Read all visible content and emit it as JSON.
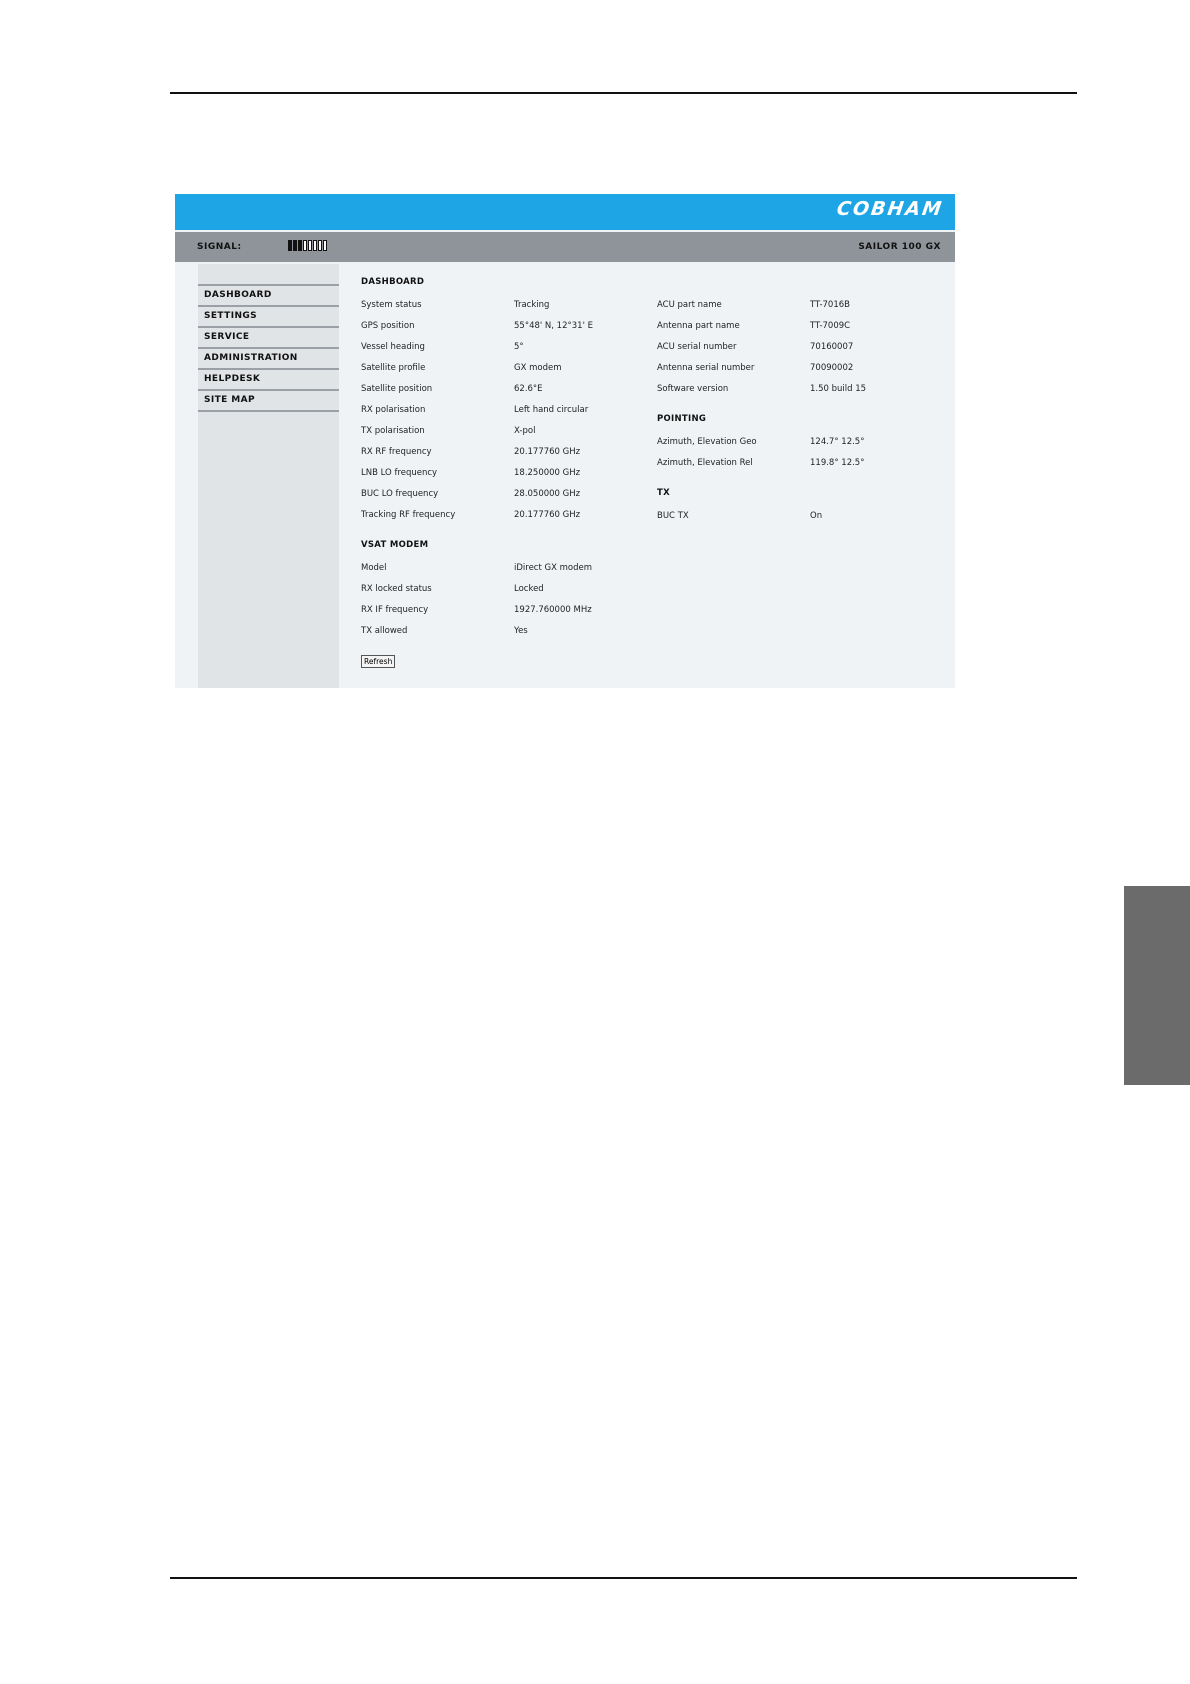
{
  "header": {
    "logo": "COBHAM",
    "signal_label": "SIGNAL:",
    "signal_level": "3 of 8",
    "product": "SAILOR 100 GX"
  },
  "sidebar": {
    "items": [
      {
        "label": "DASHBOARD"
      },
      {
        "label": "SETTINGS"
      },
      {
        "label": "SERVICE"
      },
      {
        "label": "ADMINISTRATION"
      },
      {
        "label": "HELPDESK"
      },
      {
        "label": "SITE MAP"
      }
    ]
  },
  "dashboard": {
    "title": "DASHBOARD",
    "rows": [
      {
        "label": "System status",
        "value": "Tracking"
      },
      {
        "label": "GPS position",
        "value": "55°48' N, 12°31' E"
      },
      {
        "label": "Vessel heading",
        "value": "5°"
      },
      {
        "label": "Satellite profile",
        "value": "GX modem"
      },
      {
        "label": "Satellite position",
        "value": "62.6°E"
      },
      {
        "label": "RX polarisation",
        "value": "Left hand circular"
      },
      {
        "label": "TX polarisation",
        "value": "X-pol"
      },
      {
        "label": "RX RF frequency",
        "value": "20.177760 GHz"
      },
      {
        "label": "LNB LO frequency",
        "value": "18.250000 GHz"
      },
      {
        "label": "BUC LO frequency",
        "value": "28.050000 GHz"
      },
      {
        "label": "Tracking RF frequency",
        "value": "20.177760 GHz"
      }
    ]
  },
  "info": {
    "rows": [
      {
        "label": "ACU part name",
        "value": "TT-7016B"
      },
      {
        "label": "Antenna part name",
        "value": "TT-7009C"
      },
      {
        "label": "ACU serial number",
        "value": "70160007"
      },
      {
        "label": "Antenna serial number",
        "value": "70090002"
      },
      {
        "label": "Software version",
        "value": "1.50 build 15"
      }
    ]
  },
  "pointing": {
    "title": "POINTING",
    "rows": [
      {
        "label": "Azimuth, Elevation Geo",
        "value": "124.7° 12.5°"
      },
      {
        "label": "Azimuth, Elevation Rel",
        "value": "119.8° 12.5°"
      }
    ]
  },
  "tx": {
    "title": "TX",
    "rows": [
      {
        "label": "BUC TX",
        "value": "On"
      }
    ]
  },
  "vsat": {
    "title": "VSAT MODEM",
    "rows": [
      {
        "label": "Model",
        "value": "iDirect GX modem"
      },
      {
        "label": "RX locked status",
        "value": "Locked"
      },
      {
        "label": "RX IF frequency",
        "value": "1927.760000 MHz"
      },
      {
        "label": "TX allowed",
        "value": "Yes"
      }
    ]
  },
  "refresh_label": "Refresh"
}
